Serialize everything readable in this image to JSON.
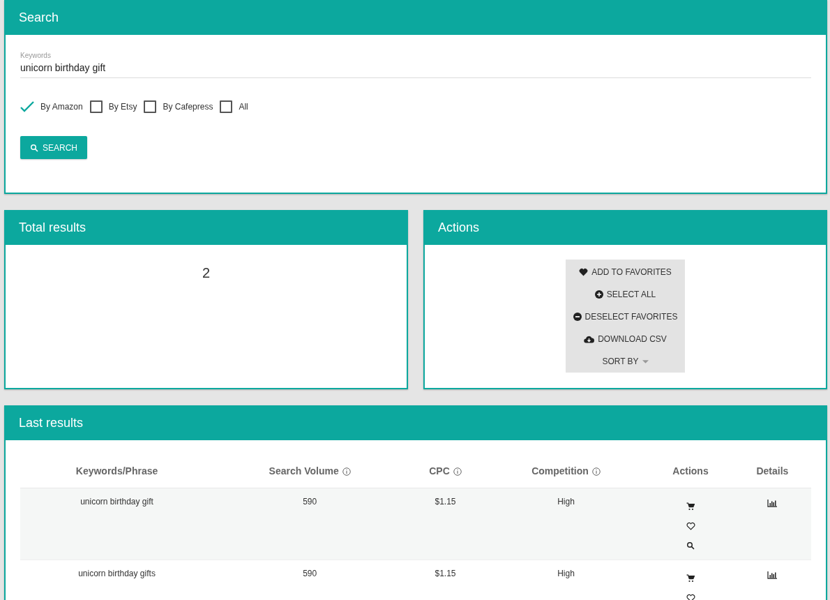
{
  "search_panel": {
    "title": "Search",
    "keywords": {
      "label": "Keywords",
      "value": "unicorn birthday gift"
    },
    "sources": [
      {
        "label": "By Amazon",
        "checked": true
      },
      {
        "label": "By Etsy",
        "checked": false
      },
      {
        "label": "By Cafepress",
        "checked": false
      },
      {
        "label": "All",
        "checked": false
      }
    ],
    "button": "SEARCH"
  },
  "total_panel": {
    "title": "Total results",
    "count": "2"
  },
  "actions_panel": {
    "title": "Actions",
    "items": [
      {
        "kind": "favorite",
        "label": "ADD TO FAVORITES"
      },
      {
        "kind": "select",
        "label": "SELECT ALL"
      },
      {
        "kind": "deselect",
        "label": "DESELECT FAVORITES"
      },
      {
        "kind": "download",
        "label": "DOWNLOAD CSV"
      },
      {
        "kind": "sort",
        "label": "SORT BY"
      }
    ]
  },
  "results_panel": {
    "title": "Last results",
    "columns": [
      {
        "label": "Keywords/Phrase",
        "info": false
      },
      {
        "label": "Search Volume",
        "info": true
      },
      {
        "label": "CPC",
        "info": true
      },
      {
        "label": "Competition",
        "info": true
      },
      {
        "label": "Actions",
        "info": false
      },
      {
        "label": "Details",
        "info": false
      }
    ],
    "rows": [
      {
        "keyword": "unicorn birthday gift",
        "volume": "590",
        "cpc": "$1.15",
        "competition": "High"
      },
      {
        "keyword": "unicorn birthday gifts",
        "volume": "590",
        "cpc": "$1.15",
        "competition": "High"
      }
    ]
  }
}
